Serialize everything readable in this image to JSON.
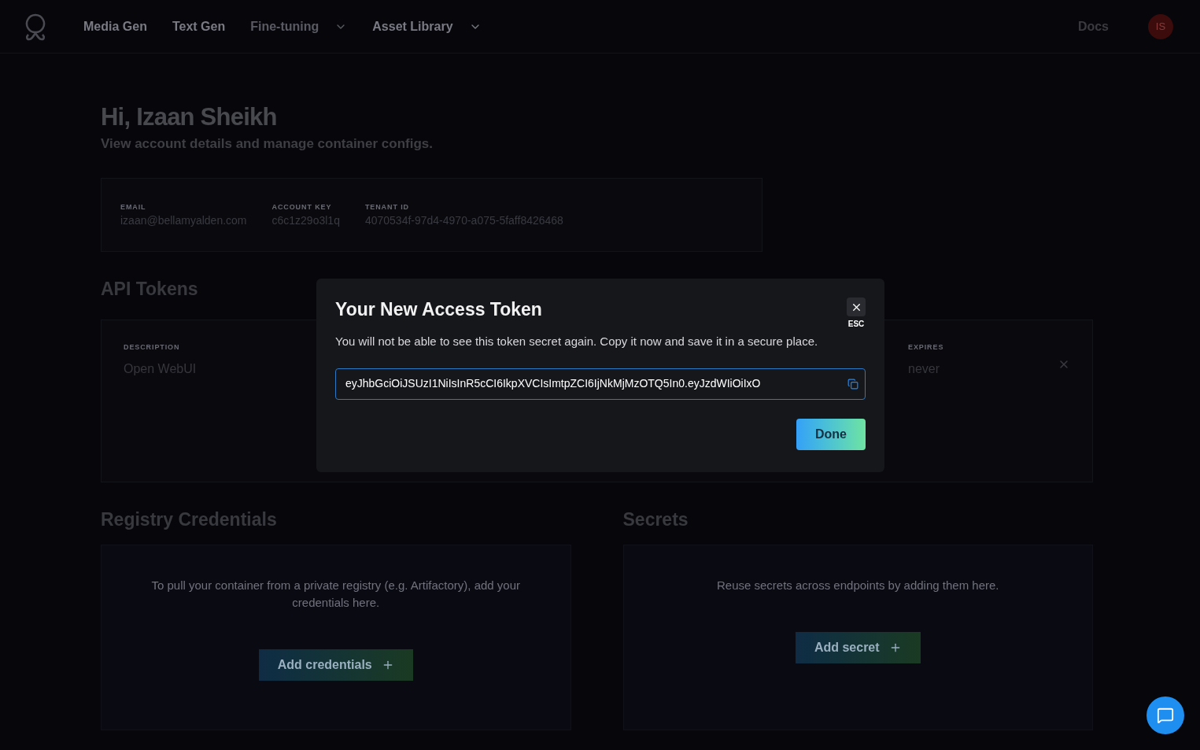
{
  "nav": {
    "items": [
      {
        "label": "Media Gen",
        "disabled": false,
        "dropdown": false
      },
      {
        "label": "Text Gen",
        "disabled": false,
        "dropdown": false
      },
      {
        "label": "Fine-tuning",
        "disabled": true,
        "dropdown": true
      },
      {
        "label": "Asset Library",
        "disabled": false,
        "dropdown": true
      }
    ],
    "docs": "Docs",
    "avatar": "IS"
  },
  "header": {
    "title": "Hi, Izaan Sheikh",
    "subtitle": "View account details and manage container configs."
  },
  "account": [
    {
      "label": "EMAIL",
      "value": "izaan@bellamyalden.com"
    },
    {
      "label": "ACCOUNT KEY",
      "value": "c6c1z29o3l1q"
    },
    {
      "label": "TENANT ID",
      "value": "4070534f-97d4-4970-a075-5faff8426468"
    }
  ],
  "api_tokens": {
    "title": "API Tokens",
    "columns": [
      {
        "label": "DESCRIPTION",
        "value": "Open WebUI"
      },
      {
        "label": "EXPIRES",
        "value": "never"
      }
    ]
  },
  "registry": {
    "title": "Registry Credentials",
    "text": "To pull your container from a private registry (e.g. Artifactory), add your credentials here.",
    "button": "Add credentials"
  },
  "secrets": {
    "title": "Secrets",
    "text": "Reuse secrets across endpoints by adding them here.",
    "button": "Add secret"
  },
  "modal": {
    "title": "Your New Access Token",
    "close_hint": "ESC",
    "text": "You will not be able to see this token secret again. Copy it now and save it in a secure place.",
    "token": "eyJhbGciOiJSUzI1NiIsInR5cCI6IkpXVCIsImtpZCI6IjNkMjMzOTQ5In0.eyJzdWIiOiIxO",
    "button": "Done"
  }
}
